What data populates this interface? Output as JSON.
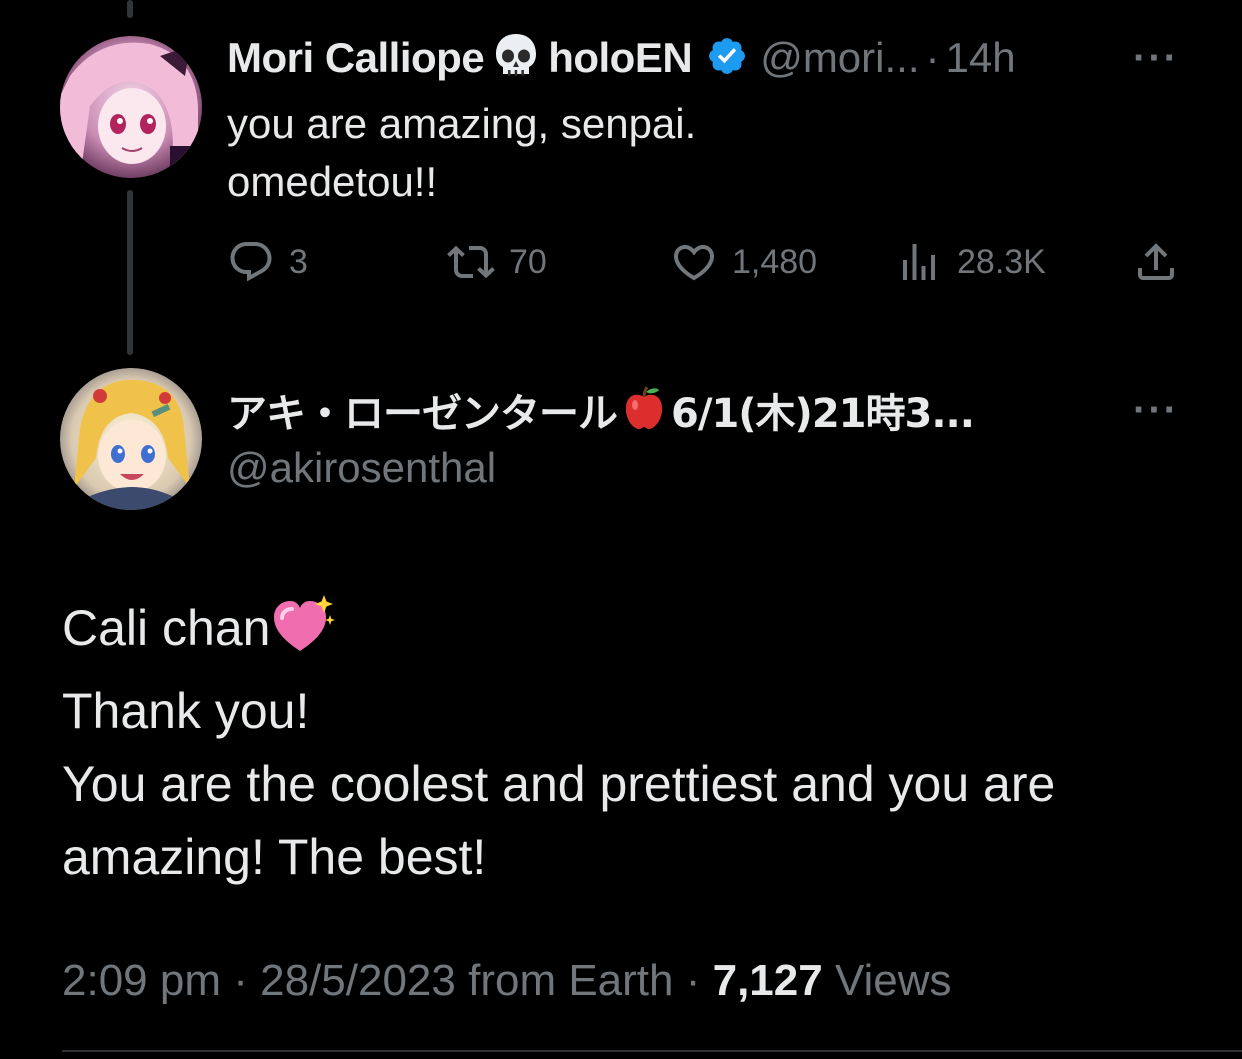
{
  "reply_tweet": {
    "display_name": "Mori Calliope",
    "name_emoji": "skull-icon",
    "name_suffix": "holoEN",
    "verified": true,
    "handle": "@mori...",
    "separator": "·",
    "time": "14h",
    "text_lines": [
      "you are amazing, senpai.",
      "omedetou!!"
    ],
    "actions": {
      "replies": "3",
      "retweets": "70",
      "likes": "1,480",
      "views": "28.3K"
    },
    "more": "···"
  },
  "main_tweet": {
    "display_name": "アキ・ローゼンタール",
    "name_emoji": "apple-icon",
    "name_suffix": "6/1(木)21時3...",
    "handle": "@akirosenthal",
    "more": "···",
    "text_lines": [
      "Cali chan",
      "Thank you!",
      "You are the coolest and prettiest and you are",
      "amazing! The best!"
    ],
    "text_emoji": "sparkling-heart-icon",
    "meta": {
      "time": "2:09 pm",
      "sep1": "·",
      "date": "28/5/2023",
      "source": "from Earth",
      "sep2": "·",
      "views_count": "7,127",
      "views_label": "Views"
    }
  },
  "colors": {
    "background": "#000000",
    "text_primary": "#e7e9ea",
    "text_secondary": "#71767b",
    "verified": "#1d9bf0",
    "thread_line": "#333639"
  }
}
